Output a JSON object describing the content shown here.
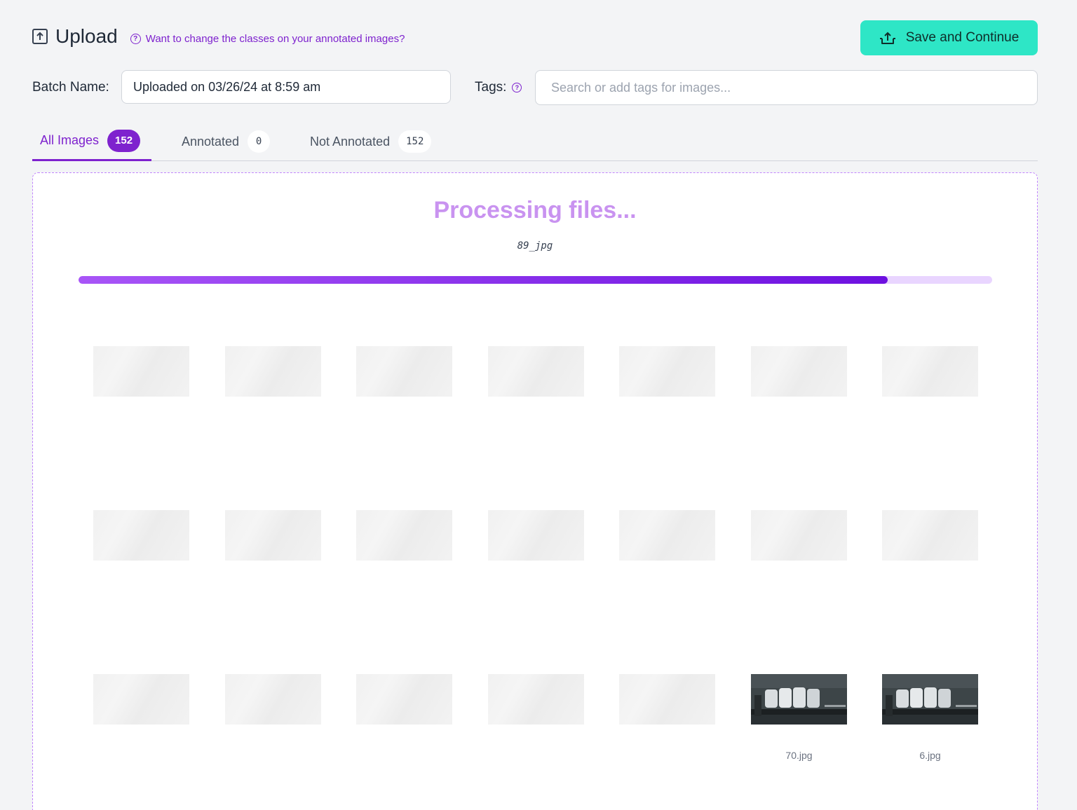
{
  "header": {
    "title": "Upload",
    "help_link": "Want to change the classes on your annotated images?",
    "save_label": "Save and Continue"
  },
  "batch": {
    "label": "Batch Name:",
    "value": "Uploaded on 03/26/24 at 8:59 am"
  },
  "tags": {
    "label": "Tags:",
    "placeholder": "Search or add tags for images..."
  },
  "tabs": [
    {
      "label": "All Images",
      "count": "152",
      "active": true
    },
    {
      "label": "Annotated",
      "count": "0",
      "active": false
    },
    {
      "label": "Not Annotated",
      "count": "152",
      "active": false
    }
  ],
  "processing": {
    "title": "Processing files...",
    "current_file": "89_jpg",
    "progress_percent": 88.6
  },
  "images": [
    {
      "name": "",
      "loaded": false
    },
    {
      "name": "",
      "loaded": false
    },
    {
      "name": "",
      "loaded": false
    },
    {
      "name": "",
      "loaded": false
    },
    {
      "name": "",
      "loaded": false
    },
    {
      "name": "",
      "loaded": false
    },
    {
      "name": "",
      "loaded": false
    },
    {
      "name": "",
      "loaded": false
    },
    {
      "name": "",
      "loaded": false
    },
    {
      "name": "",
      "loaded": false
    },
    {
      "name": "",
      "loaded": false
    },
    {
      "name": "",
      "loaded": false
    },
    {
      "name": "",
      "loaded": false
    },
    {
      "name": "",
      "loaded": false
    },
    {
      "name": "",
      "loaded": false
    },
    {
      "name": "",
      "loaded": false
    },
    {
      "name": "",
      "loaded": false
    },
    {
      "name": "",
      "loaded": false
    },
    {
      "name": "",
      "loaded": false
    },
    {
      "name": "70.jpg",
      "loaded": true
    },
    {
      "name": "6.jpg",
      "loaded": true
    }
  ],
  "colors": {
    "accent": "#7e22ce",
    "save_button": "#2ee6c6",
    "progress_fill": "#6d10e0",
    "progress_track": "#e9d5ff"
  }
}
